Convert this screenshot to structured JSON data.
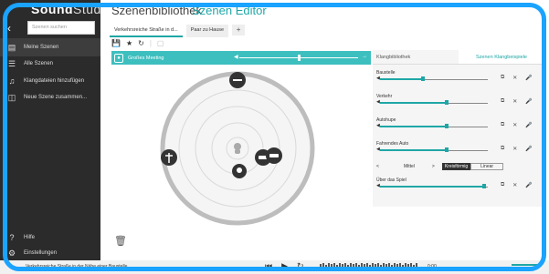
{
  "sidebar": {
    "brand_light": "Sound",
    "brand_rest": "Studio",
    "search_placeholder": "Szenen suchen",
    "items": [
      {
        "label": "Meine Szenen",
        "icon": "scenes-icon"
      },
      {
        "label": "Alle Szenen",
        "icon": "list-icon"
      },
      {
        "label": "Klangdateien hinzufügen",
        "icon": "add-audio-icon"
      },
      {
        "label": "Neue Szene zusammen...",
        "icon": "new-scene-icon"
      }
    ],
    "help": "Hilfe",
    "settings": "Einstellungen"
  },
  "header": {
    "title": "Szenenbibliothek",
    "editor": "Szenen Editor"
  },
  "tabs": [
    {
      "label": "Verkehrsreiche Straße in d..."
    },
    {
      "label": "Paar zu Hause"
    }
  ],
  "toolbar": {
    "add": "+",
    "save_icon": "save-icon",
    "star_icon": "star-icon",
    "reset_icon": "reset-icon"
  },
  "scene": {
    "name": "Großes Meeting"
  },
  "panel": {
    "tab_library": "Klangbibliothek",
    "tab_examples": "Szenen Klangbeispiele",
    "tracks": [
      {
        "name": "Baustelle",
        "level": 0.4
      },
      {
        "name": "Verkehr",
        "level": 0.62
      },
      {
        "name": "Autohupe",
        "level": 0.62
      },
      {
        "name": "Fahrendes Auto",
        "level": 0.62
      }
    ],
    "mode_prev": "<",
    "mode_value": "Mittel",
    "mode_next": ">",
    "mode_circular": "Kreisförmig",
    "mode_linear": "Linear",
    "last_track": {
      "name": "Über das Spiel",
      "level": 0.97
    }
  },
  "bottom": {
    "status": "Verkehrsreiche Straße in der Nähe einer Baustelle",
    "zoom": "0:00"
  },
  "colors": {
    "accent": "#1fa6a6",
    "sidebar": "#2b2b2b",
    "frame": "#1aa3ff"
  }
}
